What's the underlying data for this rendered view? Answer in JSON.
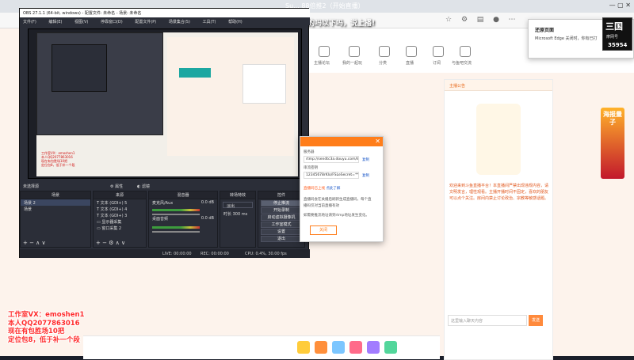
{
  "browser": {
    "tab_title": "Su... 88倍推2（开始直播）",
    "site_nav": [
      "主播论坛",
      "我的一起玩",
      "分类",
      "直播",
      "订阅",
      "与鱼吧交流",
      "鱼乐",
      "历史"
    ],
    "side_ad_text": "海报量子",
    "chat_title": "主播公告",
    "chat_text": "欢迎来到斗鱼直播平台！本直播间严禁出现违规内容，请文明发言，理性观看。主播开播时间不固定，喜欢的朋友可以点个关注。房间内禁止讨论政治、宗教等敏感话题。",
    "chat_input_placeholder": "这里输入聊天内容",
    "send_label": "发送"
  },
  "edge_popup": {
    "title": "还原页面",
    "message": "Microsoft Edge 关闭时，你有已打"
  },
  "logo_badge": {
    "line1": "三国",
    "line2": "摩网号",
    "line3": "35954"
  },
  "overlay": {
    "title": "钻都开通的吗以下吗，说上播!"
  },
  "obs": {
    "title": "OBS 27.1.1 (64-bit, windows) - 配置文件: 未命名 - 场景: 未命名",
    "menu": [
      "文件(F)",
      "编辑(E)",
      "视图(V)",
      "停靠窗口(D)",
      "配置文件(P)",
      "场景集合(S)",
      "工具(T)",
      "帮助(H)"
    ],
    "scene_label": "未选择源",
    "props_label": "属性",
    "filters_label": "滤镜",
    "docks": {
      "scenes": {
        "title": "场景",
        "items": [
          "场景 2",
          "场景"
        ]
      },
      "sources": {
        "title": "来源",
        "items": [
          "文本 (GDI+) 5",
          "文本 (GDI+) 4",
          "文本 (GDI+) 3",
          "显示器采集",
          "窗口采集 2"
        ]
      },
      "mixer": {
        "title": "混音器",
        "tracks": [
          {
            "name": "麦克风/Aux",
            "db": "0.0 dB"
          },
          {
            "name": "桌面音频",
            "db": "0.0 dB"
          }
        ]
      },
      "transitions": {
        "title": "转场特效",
        "type": "淡出",
        "duration_label": "时长",
        "duration": "300 ms"
      },
      "controls": {
        "title": "控件",
        "buttons": [
          "停止推流",
          "开始录制",
          "启动虚拟摄像机",
          "工作室模式",
          "设置",
          "退出"
        ]
      }
    },
    "status": {
      "live": "LIVE: 00:00:00",
      "rec": "REC: 00:00:00",
      "cpu": "CPU: 0.4%, 30.00 fps"
    }
  },
  "stream_dialog": {
    "server_label": "服务器",
    "server_value": "rtmp://sendtc3a.douyu.com/live",
    "key_label": "串流密钥",
    "key_value": "12345678rKlo/FSLeSecret=********",
    "copy1": "复制",
    "copy2": "复制",
    "hint1": "直播码已上线",
    "hint_link": "点此了解",
    "hint2": "直播码会在关播后刷新生成直播码，每个直",
    "hint3": "播码仅对当前直播有效",
    "hint4": "如需要推流地址请到rtmp地址发生变化。",
    "close_btn": "关闭"
  },
  "promo": {
    "lines": [
      "工作室VX：emoshen1",
      "本人QQ2077863016",
      "现在有包胜场10把",
      "定位包8，低于补一个段"
    ]
  },
  "colors": {
    "accent": "#ff7d1a",
    "promo_red": "#ff2b2b",
    "obs_bg": "#2b2e38"
  }
}
